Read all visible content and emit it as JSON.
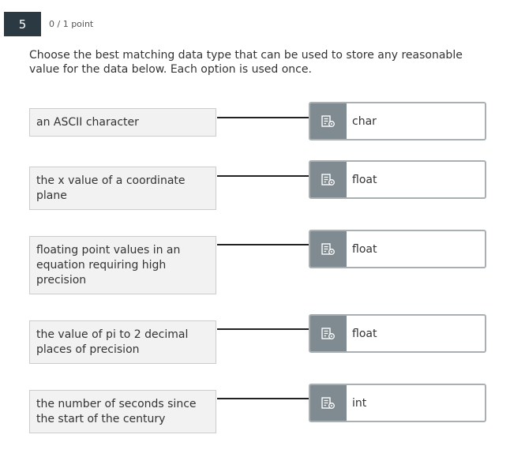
{
  "question": {
    "number": "5",
    "points": "0 / 1 point",
    "prompt": "Choose the best matching data type that can be used to store any reasonable value for the data below.  Each option is used once."
  },
  "pairs": [
    {
      "prompt": "an ASCII character",
      "answer": "char"
    },
    {
      "prompt": "the x value of a coordinate plane",
      "answer": "float"
    },
    {
      "prompt": "floating point values in an equation requiring high precision",
      "answer": "float"
    },
    {
      "prompt": "the value of pi to 2 decimal places of precision",
      "answer": "float"
    },
    {
      "prompt": "the number of seconds since the start of the century",
      "answer": "int"
    }
  ],
  "icons": {
    "drag_handle": "draggable-list-icon"
  },
  "colors": {
    "badge_bg": "#2b3a42",
    "handle_bg": "#7f8b91",
    "prompt_box_bg": "#f2f2f2",
    "answer_border": "#a9b0b4"
  }
}
